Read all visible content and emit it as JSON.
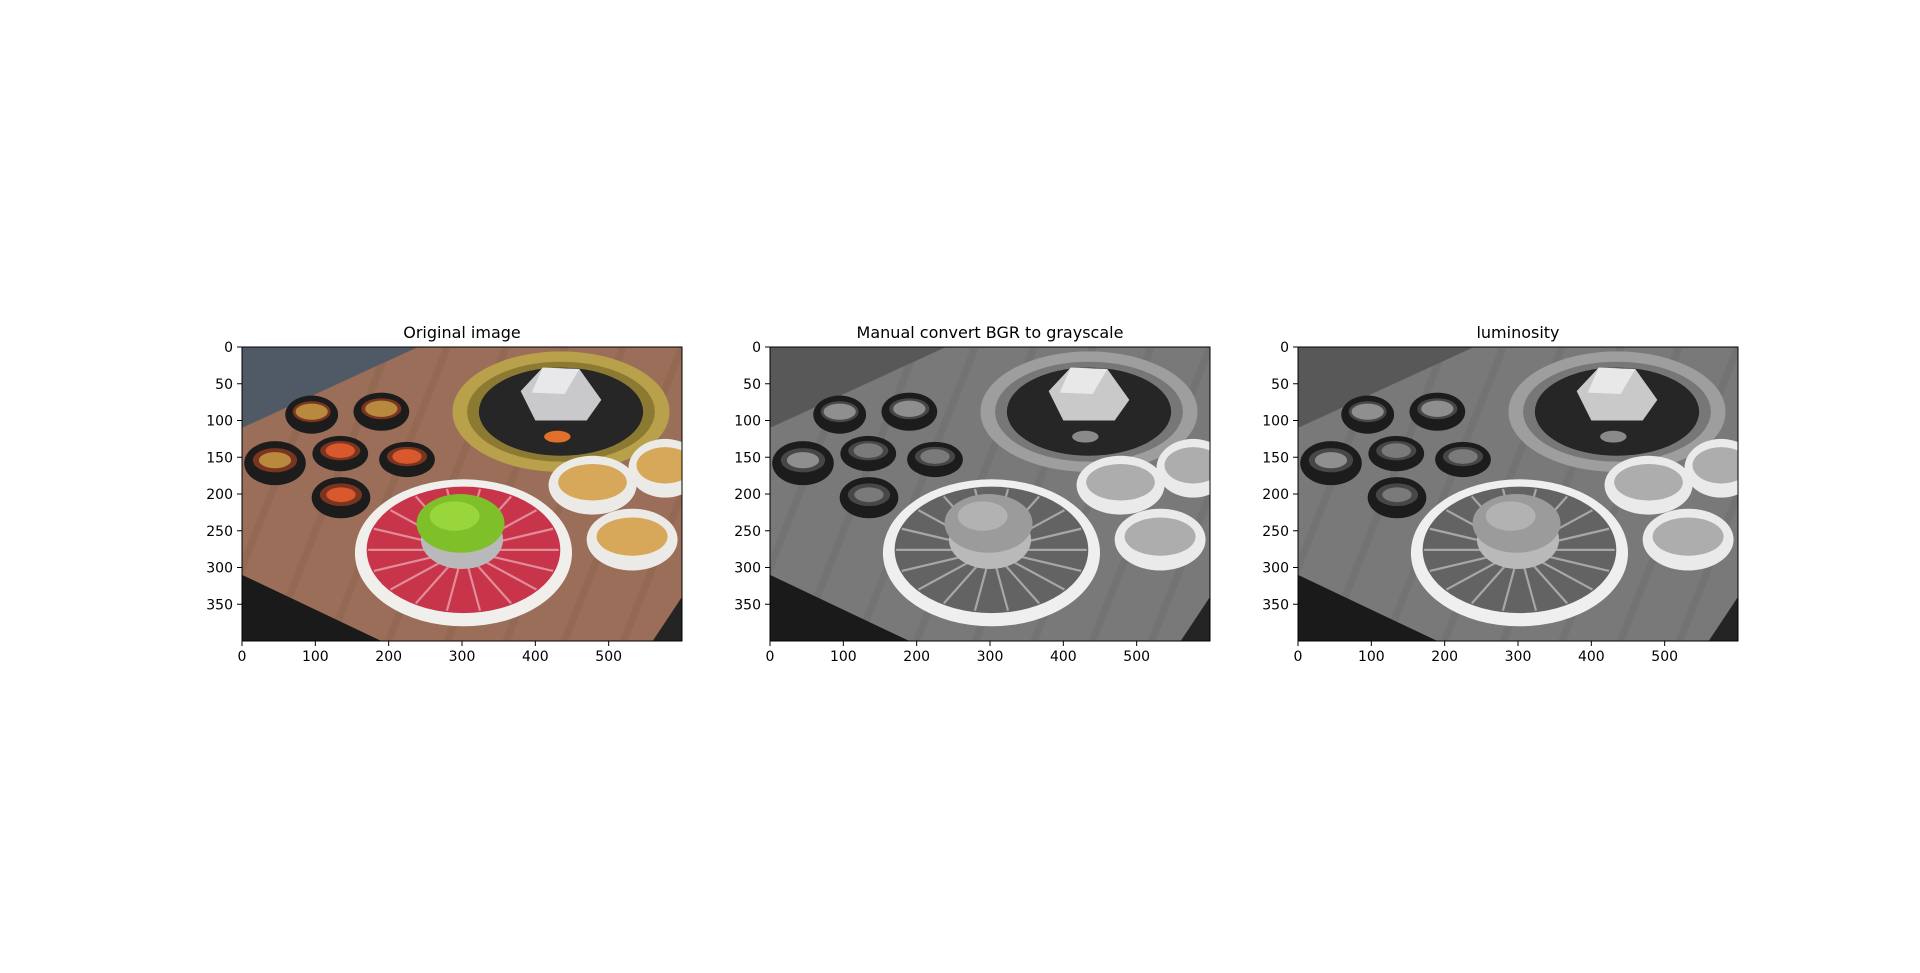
{
  "chart_data": [
    {
      "type": "image",
      "title": "Original image",
      "render": "color",
      "xlim": [
        0,
        600
      ],
      "ylim": [
        400,
        0
      ],
      "xticks": [
        0,
        100,
        200,
        300,
        400,
        500
      ],
      "yticks": [
        0,
        50,
        100,
        150,
        200,
        250,
        300,
        350
      ],
      "grid": false
    },
    {
      "type": "image",
      "title": "Manual convert BGR to grayscale",
      "render": "grayscale",
      "xlim": [
        0,
        600
      ],
      "ylim": [
        400,
        0
      ],
      "xticks": [
        0,
        100,
        200,
        300,
        400,
        500
      ],
      "yticks": [
        0,
        50,
        100,
        150,
        200,
        250,
        300,
        350
      ],
      "grid": false
    },
    {
      "type": "image",
      "title": "luminosity",
      "render": "grayscale",
      "xlim": [
        0,
        600
      ],
      "ylim": [
        400,
        0
      ],
      "xticks": [
        0,
        100,
        200,
        300,
        400,
        500
      ],
      "yticks": [
        0,
        50,
        100,
        150,
        200,
        250,
        300,
        350
      ],
      "grid": false
    }
  ]
}
